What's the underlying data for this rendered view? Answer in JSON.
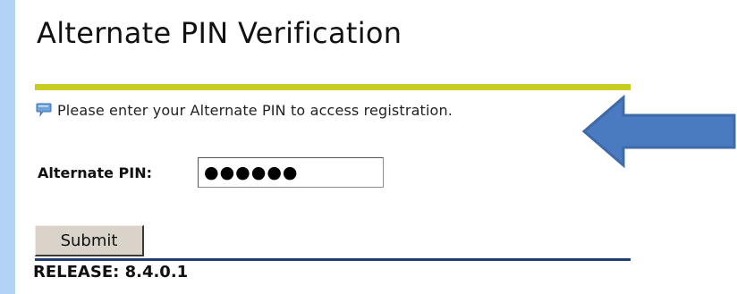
{
  "page": {
    "title": "Alternate PIN Verification",
    "info_icon": "info-speech-icon",
    "info_text": "Please enter your Alternate PIN to access registration.",
    "pin_label": "Alternate PIN:",
    "pin_value": "●●●●●●",
    "submit_label": "Submit",
    "release": "RELEASE: 8.4.0.1"
  },
  "annotation": {
    "arrow_icon": "left-arrow-icon",
    "arrow_color": "#4a7ac0"
  },
  "colors": {
    "background": "#b3d3f4",
    "rule_yellow": "#c9cc21",
    "rule_blue": "#1f3e72",
    "button_face": "#d9d3ca"
  }
}
